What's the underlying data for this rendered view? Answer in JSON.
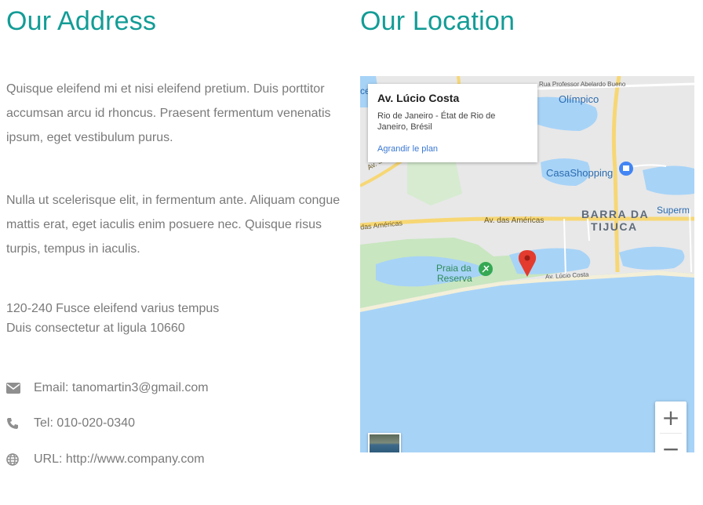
{
  "address": {
    "title": "Our Address",
    "paragraph1": "Quisque eleifend mi et nisi eleifend pretium. Duis porttitor accumsan arcu id rhoncus. Praesent fermentum venenatis ipsum, eget vestibulum purus.",
    "paragraph2": "Nulla ut scelerisque elit, in fermentum ante. Aliquam congue mattis erat, eget iaculis enim posuere nec. Quisque risus turpis, tempus in iaculis.",
    "street_line1": "120-240 Fusce eleifend varius tempus",
    "street_line2": "Duis consectetur at ligula 10660",
    "email": "Email: tanomartin3@gmail.com",
    "tel": "Tel: 010-020-0340",
    "url": "URL: http://www.company.com"
  },
  "location": {
    "title": "Our Location",
    "popup": {
      "title": "Av. Lúcio Costa",
      "address": "Rio de Janeiro - État de Rio de Janeiro, Brésil",
      "link": "Agrandir le plan"
    },
    "map_labels": {
      "olimpico": "Olímpico",
      "abelardo": "Rua Professor Abelardo Bueno",
      "casashopping": "CasaShopping",
      "barra": "BARRA DA",
      "tijuca": "TIJUCA",
      "supermarket": "Superm",
      "das_americas_left": "das Américas",
      "das_americas_right": "Av. das Américas",
      "praia1": "Praia da",
      "praia2": "Reserva",
      "lucio_costa": "Av. Lúcio Costa",
      "av_sa": "Av. Sa",
      "ce": "ce"
    },
    "zoom_in": "+",
    "zoom_out": "−",
    "colors": {
      "water": "#a7d3f7",
      "land": "#e8e8e8",
      "green": "#c8e6c0",
      "road": "#f7d774",
      "pin": "#e33b2e"
    }
  }
}
